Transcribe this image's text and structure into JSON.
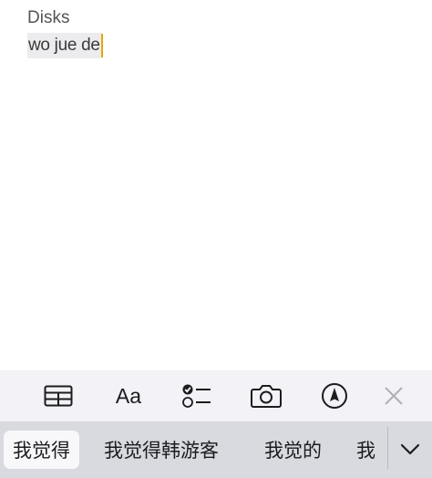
{
  "note": {
    "line1": "Disks",
    "composing_text": "wo jue de"
  },
  "toolbar": {
    "table_icon": "table-icon",
    "format_label": "Aa",
    "checklist_icon": "checklist-icon",
    "camera_icon": "camera-icon",
    "markup_icon": "pen-markup-icon",
    "close_icon": "close-icon"
  },
  "candidates": {
    "items": [
      "我觉得",
      "我觉得韩游客",
      "我觉的",
      "我"
    ],
    "selected_index": 0,
    "expand_icon": "chevron-down-icon"
  },
  "colors": {
    "caret": "#e6a700",
    "toolbar_bg": "#f2f2f7",
    "candidate_bg": "#d8dadf",
    "disabled_icon": "#b0b0b5"
  }
}
